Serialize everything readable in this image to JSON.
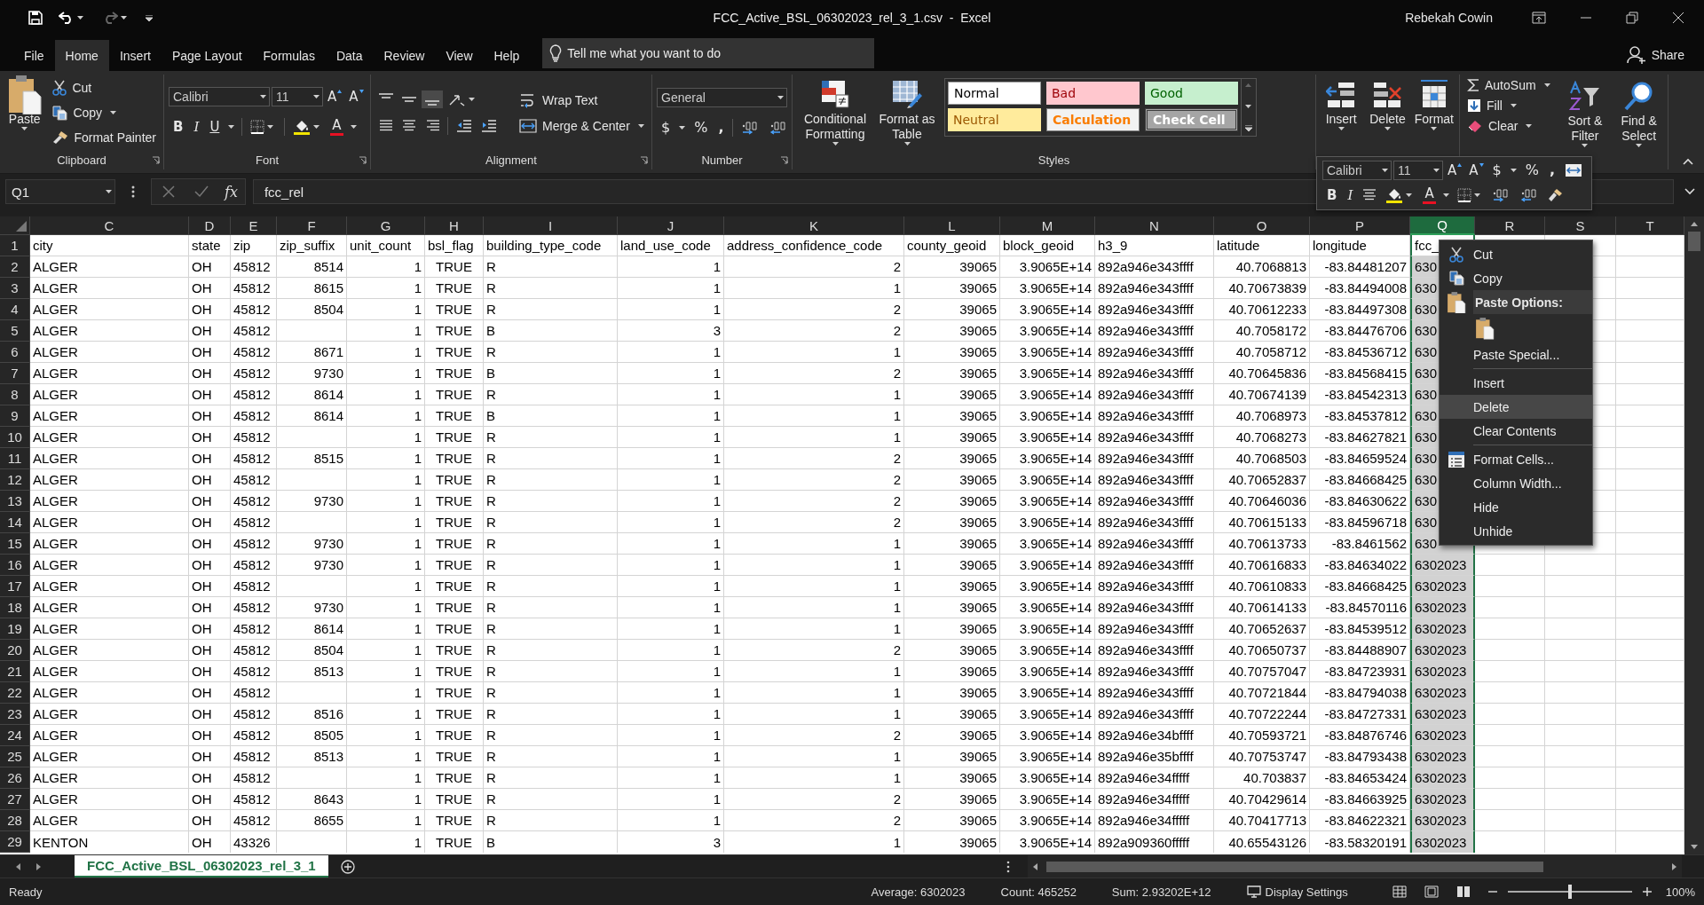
{
  "window": {
    "title": "FCC_Active_BSL_06302023_rel_3_1.csv  -  Excel",
    "user": "Rebekah Cowin"
  },
  "menu_tabs": [
    {
      "label": "File",
      "selected": false
    },
    {
      "label": "Home",
      "selected": true
    },
    {
      "label": "Insert",
      "selected": false
    },
    {
      "label": "Page Layout",
      "selected": false
    },
    {
      "label": "Formulas",
      "selected": false
    },
    {
      "label": "Data",
      "selected": false
    },
    {
      "label": "Review",
      "selected": false
    },
    {
      "label": "View",
      "selected": false
    },
    {
      "label": "Help",
      "selected": false
    }
  ],
  "tell_me": {
    "placeholder": "Tell me what you want to do"
  },
  "share": "Share",
  "ribbon": {
    "clipboard": {
      "label": "Clipboard",
      "paste": "Paste",
      "cut": "Cut",
      "copy": "Copy",
      "format_painter": "Format Painter"
    },
    "font": {
      "label": "Font",
      "font_name": "Calibri",
      "font_size": "11",
      "grow": "A",
      "shrink": "A",
      "bold": "B",
      "italic": "I",
      "underline": "U",
      "font_color": "A"
    },
    "alignment": {
      "label": "Alignment",
      "wrap_text": "Wrap Text",
      "merge_center": "Merge & Center"
    },
    "number": {
      "label": "Number",
      "format": "General",
      "currency": "$",
      "percent": "%",
      "comma": ","
    },
    "styles": {
      "label": "Styles",
      "conditional_formatting": "Conditional Formatting",
      "format_as_table": "Format as Table",
      "cell_styles": [
        {
          "name": "Normal",
          "kind": "normal"
        },
        {
          "name": "Bad",
          "kind": "bad"
        },
        {
          "name": "Good",
          "kind": "good"
        },
        {
          "name": "Neutral",
          "kind": "neutral"
        },
        {
          "name": "Calculation",
          "kind": "calculation"
        },
        {
          "name": "Check Cell",
          "kind": "check"
        }
      ]
    },
    "cells": {
      "insert": "Insert",
      "delete": "Delete",
      "format": "Format"
    },
    "editing": {
      "autosum": "AutoSum",
      "fill": "Fill",
      "clear": "Clear",
      "sort_filter": "Sort & Filter",
      "find_select": "Find & Select"
    }
  },
  "mini_toolbar": {
    "font_name": "Calibri",
    "font_size": "11",
    "grow": "A",
    "shrink": "A",
    "currency": "$",
    "percent": "%",
    "comma": ",",
    "bold": "B",
    "italic": "I",
    "font_color": "A"
  },
  "formula_bar": {
    "name_box": "Q1",
    "function_label": "fx",
    "formula": "fcc_rel"
  },
  "sheet": {
    "columns": [
      {
        "letter": "C",
        "kind": "text",
        "selected": false
      },
      {
        "letter": "D",
        "kind": "text",
        "selected": false
      },
      {
        "letter": "E",
        "kind": "text",
        "selected": false
      },
      {
        "letter": "F",
        "kind": "number",
        "selected": false
      },
      {
        "letter": "G",
        "kind": "number",
        "selected": false
      },
      {
        "letter": "H",
        "kind": "flag",
        "selected": false
      },
      {
        "letter": "I",
        "kind": "text",
        "selected": false
      },
      {
        "letter": "J",
        "kind": "number",
        "selected": false
      },
      {
        "letter": "K",
        "kind": "number",
        "selected": false
      },
      {
        "letter": "L",
        "kind": "number",
        "selected": false
      },
      {
        "letter": "M",
        "kind": "number",
        "selected": false
      },
      {
        "letter": "N",
        "kind": "text",
        "selected": false
      },
      {
        "letter": "O",
        "kind": "number",
        "selected": false
      },
      {
        "letter": "P",
        "kind": "number",
        "selected": false
      },
      {
        "letter": "Q",
        "kind": "text",
        "selected": true
      },
      {
        "letter": "R",
        "kind": "text",
        "selected": false
      },
      {
        "letter": "S",
        "kind": "text",
        "selected": false
      },
      {
        "letter": "T",
        "kind": "text",
        "selected": false
      }
    ],
    "rows": [
      {
        "number": "1",
        "kind": "header",
        "active": true,
        "cells": [
          "city",
          "state",
          "zip",
          "zip_suffix",
          "unit_count",
          "bsl_flag",
          "building_type_code",
          "land_use_code",
          "address_confidence_code",
          "county_geoid",
          "block_geoid",
          "h3_9",
          "latitude",
          "longitude",
          "fcc_"
        ]
      },
      {
        "number": "2",
        "kind": "data",
        "active": false,
        "cells": [
          "ALGER",
          "OH",
          "45812",
          "8514",
          "1",
          "TRUE",
          "R",
          "1",
          "2",
          "39065",
          "3.9065E+14",
          "892a946e343ffff",
          "40.7068813",
          "-83.84481207",
          "630"
        ]
      },
      {
        "number": "3",
        "kind": "data",
        "active": false,
        "cells": [
          "ALGER",
          "OH",
          "45812",
          "8615",
          "1",
          "TRUE",
          "R",
          "1",
          "1",
          "39065",
          "3.9065E+14",
          "892a946e343ffff",
          "40.70673839",
          "-83.84494008",
          "630"
        ]
      },
      {
        "number": "4",
        "kind": "data",
        "active": false,
        "cells": [
          "ALGER",
          "OH",
          "45812",
          "8504",
          "1",
          "TRUE",
          "R",
          "1",
          "2",
          "39065",
          "3.9065E+14",
          "892a946e343ffff",
          "40.70612233",
          "-83.84497308",
          "630"
        ]
      },
      {
        "number": "5",
        "kind": "data",
        "active": false,
        "cells": [
          "ALGER",
          "OH",
          "45812",
          null,
          "1",
          "TRUE",
          "B",
          "3",
          "2",
          "39065",
          "3.9065E+14",
          "892a946e343ffff",
          "40.7058172",
          "-83.84476706",
          "630"
        ]
      },
      {
        "number": "6",
        "kind": "data",
        "active": false,
        "cells": [
          "ALGER",
          "OH",
          "45812",
          "8671",
          "1",
          "TRUE",
          "R",
          "1",
          "1",
          "39065",
          "3.9065E+14",
          "892a946e343ffff",
          "40.7058712",
          "-83.84536712",
          "630"
        ]
      },
      {
        "number": "7",
        "kind": "data",
        "active": false,
        "cells": [
          "ALGER",
          "OH",
          "45812",
          "9730",
          "1",
          "TRUE",
          "B",
          "1",
          "2",
          "39065",
          "3.9065E+14",
          "892a946e343ffff",
          "40.70645836",
          "-83.84568415",
          "630"
        ]
      },
      {
        "number": "8",
        "kind": "data",
        "active": false,
        "cells": [
          "ALGER",
          "OH",
          "45812",
          "8614",
          "1",
          "TRUE",
          "R",
          "1",
          "1",
          "39065",
          "3.9065E+14",
          "892a946e343ffff",
          "40.70674139",
          "-83.84542313",
          "630"
        ]
      },
      {
        "number": "9",
        "kind": "data",
        "active": false,
        "cells": [
          "ALGER",
          "OH",
          "45812",
          "8614",
          "1",
          "TRUE",
          "B",
          "1",
          "1",
          "39065",
          "3.9065E+14",
          "892a946e343ffff",
          "40.7068973",
          "-83.84537812",
          "630"
        ]
      },
      {
        "number": "10",
        "kind": "data",
        "active": false,
        "cells": [
          "ALGER",
          "OH",
          "45812",
          null,
          "1",
          "TRUE",
          "R",
          "1",
          "1",
          "39065",
          "3.9065E+14",
          "892a946e343ffff",
          "40.7068273",
          "-83.84627821",
          "630"
        ]
      },
      {
        "number": "11",
        "kind": "data",
        "active": false,
        "cells": [
          "ALGER",
          "OH",
          "45812",
          "8515",
          "1",
          "TRUE",
          "R",
          "1",
          "2",
          "39065",
          "3.9065E+14",
          "892a946e343ffff",
          "40.7068503",
          "-83.84659524",
          "630"
        ]
      },
      {
        "number": "12",
        "kind": "data",
        "active": false,
        "cells": [
          "ALGER",
          "OH",
          "45812",
          null,
          "1",
          "TRUE",
          "R",
          "1",
          "2",
          "39065",
          "3.9065E+14",
          "892a946e343ffff",
          "40.70652837",
          "-83.84668425",
          "630"
        ]
      },
      {
        "number": "13",
        "kind": "data",
        "active": false,
        "cells": [
          "ALGER",
          "OH",
          "45812",
          "9730",
          "1",
          "TRUE",
          "R",
          "1",
          "2",
          "39065",
          "3.9065E+14",
          "892a946e343ffff",
          "40.70646036",
          "-83.84630622",
          "630"
        ]
      },
      {
        "number": "14",
        "kind": "data",
        "active": false,
        "cells": [
          "ALGER",
          "OH",
          "45812",
          null,
          "1",
          "TRUE",
          "R",
          "1",
          "2",
          "39065",
          "3.9065E+14",
          "892a946e343ffff",
          "40.70615133",
          "-83.84596718",
          "630"
        ]
      },
      {
        "number": "15",
        "kind": "data",
        "active": false,
        "cells": [
          "ALGER",
          "OH",
          "45812",
          "9730",
          "1",
          "TRUE",
          "R",
          "1",
          "1",
          "39065",
          "3.9065E+14",
          "892a946e343ffff",
          "40.70613733",
          "-83.8461562",
          "630"
        ]
      },
      {
        "number": "16",
        "kind": "data",
        "active": false,
        "cells": [
          "ALGER",
          "OH",
          "45812",
          "9730",
          "1",
          "TRUE",
          "R",
          "1",
          "1",
          "39065",
          "3.9065E+14",
          "892a946e343ffff",
          "40.70616833",
          "-83.84634022",
          "6302023"
        ]
      },
      {
        "number": "17",
        "kind": "data",
        "active": false,
        "cells": [
          "ALGER",
          "OH",
          "45812",
          null,
          "1",
          "TRUE",
          "R",
          "1",
          "1",
          "39065",
          "3.9065E+14",
          "892a946e343ffff",
          "40.70610833",
          "-83.84668425",
          "6302023"
        ]
      },
      {
        "number": "18",
        "kind": "data",
        "active": false,
        "cells": [
          "ALGER",
          "OH",
          "45812",
          "9730",
          "1",
          "TRUE",
          "R",
          "1",
          "1",
          "39065",
          "3.9065E+14",
          "892a946e343ffff",
          "40.70614133",
          "-83.84570116",
          "6302023"
        ]
      },
      {
        "number": "19",
        "kind": "data",
        "active": false,
        "cells": [
          "ALGER",
          "OH",
          "45812",
          "8614",
          "1",
          "TRUE",
          "R",
          "1",
          "1",
          "39065",
          "3.9065E+14",
          "892a946e343ffff",
          "40.70652637",
          "-83.84539512",
          "6302023"
        ]
      },
      {
        "number": "20",
        "kind": "data",
        "active": false,
        "cells": [
          "ALGER",
          "OH",
          "45812",
          "8504",
          "1",
          "TRUE",
          "R",
          "1",
          "2",
          "39065",
          "3.9065E+14",
          "892a946e343ffff",
          "40.70650737",
          "-83.84488907",
          "6302023"
        ]
      },
      {
        "number": "21",
        "kind": "data",
        "active": false,
        "cells": [
          "ALGER",
          "OH",
          "45812",
          "8513",
          "1",
          "TRUE",
          "R",
          "1",
          "1",
          "39065",
          "3.9065E+14",
          "892a946e343ffff",
          "40.70757047",
          "-83.84723931",
          "6302023"
        ]
      },
      {
        "number": "22",
        "kind": "data",
        "active": false,
        "cells": [
          "ALGER",
          "OH",
          "45812",
          null,
          "1",
          "TRUE",
          "R",
          "1",
          "1",
          "39065",
          "3.9065E+14",
          "892a946e343ffff",
          "40.70721844",
          "-83.84794038",
          "6302023"
        ]
      },
      {
        "number": "23",
        "kind": "data",
        "active": false,
        "cells": [
          "ALGER",
          "OH",
          "45812",
          "8516",
          "1",
          "TRUE",
          "R",
          "1",
          "1",
          "39065",
          "3.9065E+14",
          "892a946e343ffff",
          "40.70722244",
          "-83.84727331",
          "6302023"
        ]
      },
      {
        "number": "24",
        "kind": "data",
        "active": false,
        "cells": [
          "ALGER",
          "OH",
          "45812",
          "8505",
          "1",
          "TRUE",
          "R",
          "1",
          "2",
          "39065",
          "3.9065E+14",
          "892a946e34bffff",
          "40.70593721",
          "-83.84876746",
          "6302023"
        ]
      },
      {
        "number": "25",
        "kind": "data",
        "active": false,
        "cells": [
          "ALGER",
          "OH",
          "45812",
          "8513",
          "1",
          "TRUE",
          "R",
          "1",
          "1",
          "39065",
          "3.9065E+14",
          "892a946e35bffff",
          "40.70753747",
          "-83.84793438",
          "6302023"
        ]
      },
      {
        "number": "26",
        "kind": "data",
        "active": false,
        "cells": [
          "ALGER",
          "OH",
          "45812",
          null,
          "1",
          "TRUE",
          "R",
          "1",
          "1",
          "39065",
          "3.9065E+14",
          "892a946e34fffff",
          "40.703837",
          "-83.84653424",
          "6302023"
        ]
      },
      {
        "number": "27",
        "kind": "data",
        "active": false,
        "cells": [
          "ALGER",
          "OH",
          "45812",
          "8643",
          "1",
          "TRUE",
          "R",
          "1",
          "2",
          "39065",
          "3.9065E+14",
          "892a946e34fffff",
          "40.70429614",
          "-83.84663925",
          "6302023"
        ]
      },
      {
        "number": "28",
        "kind": "data",
        "active": false,
        "cells": [
          "ALGER",
          "OH",
          "45812",
          "8655",
          "1",
          "TRUE",
          "R",
          "1",
          "2",
          "39065",
          "3.9065E+14",
          "892a946e34fffff",
          "40.70417713",
          "-83.84622321",
          "6302023"
        ]
      },
      {
        "number": "29",
        "kind": "data",
        "active": false,
        "cells": [
          "KENTON",
          "OH",
          "43326",
          null,
          "1",
          "TRUE",
          "B",
          "3",
          "1",
          "39065",
          "3.9065E+14",
          "892a909360fffff",
          "40.65543126",
          "-83.58320191",
          "6302023"
        ]
      }
    ]
  },
  "context_menu": [
    {
      "kind": "command",
      "label": "Cut",
      "highlighted": false
    },
    {
      "kind": "command",
      "label": "Copy",
      "highlighted": false
    },
    {
      "kind": "heading",
      "label": "Paste Options:"
    },
    {
      "kind": "paste_button"
    },
    {
      "kind": "command",
      "label": "Paste Special...",
      "highlighted": false
    },
    {
      "kind": "separator"
    },
    {
      "kind": "command",
      "label": "Insert",
      "highlighted": false
    },
    {
      "kind": "command",
      "label": "Delete",
      "highlighted": true
    },
    {
      "kind": "command",
      "label": "Clear Contents",
      "highlighted": false
    },
    {
      "kind": "separator"
    },
    {
      "kind": "command",
      "label": "Format Cells...",
      "highlighted": false
    },
    {
      "kind": "command",
      "label": "Column Width...",
      "highlighted": false
    },
    {
      "kind": "command",
      "label": "Hide",
      "highlighted": false
    },
    {
      "kind": "command",
      "label": "Unhide",
      "highlighted": false
    }
  ],
  "sheet_tabs": [
    {
      "label": "FCC_Active_BSL_06302023_rel_3_1",
      "selected": true
    }
  ],
  "status_bar": {
    "ready": "Ready",
    "average": "Average: 6302023",
    "count": "Count: 465252",
    "sum": "Sum: 2.93202E+12",
    "display_settings": "Display Settings",
    "zoom": "100%",
    "zoom_slider": {
      "level": 0.5
    }
  }
}
